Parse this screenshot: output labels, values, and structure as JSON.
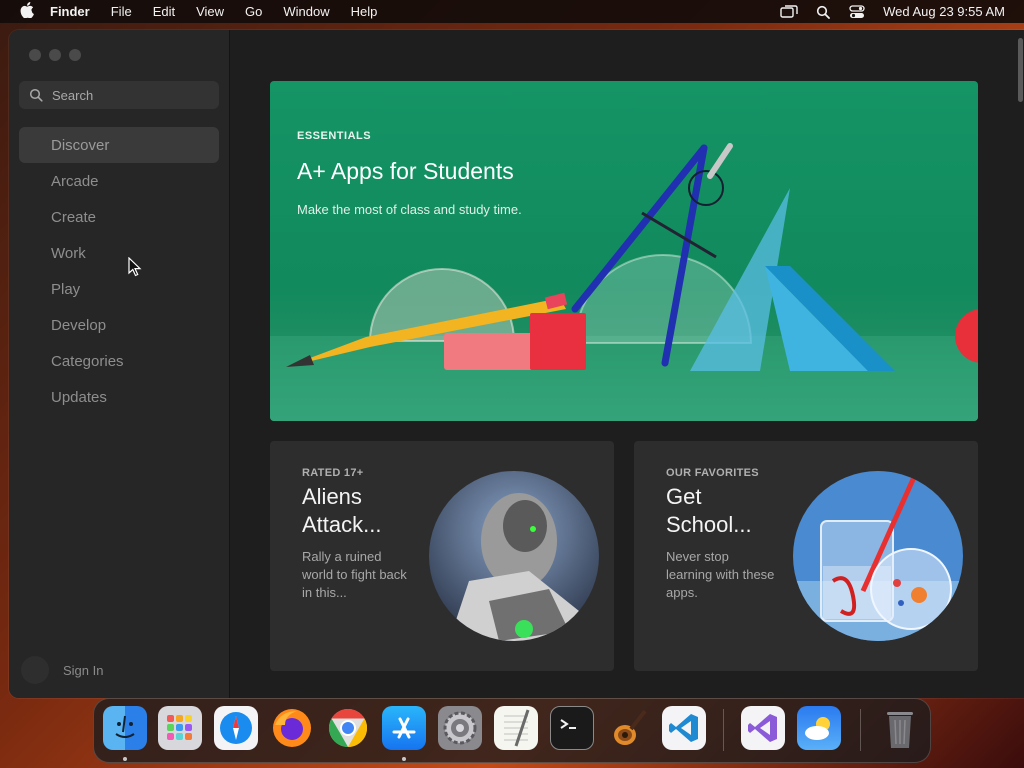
{
  "menubar": {
    "app_name": "Finder",
    "menus": [
      "File",
      "Edit",
      "View",
      "Go",
      "Window",
      "Help"
    ],
    "status_icons": [
      "screen-mirroring-icon",
      "spotlight-search-icon",
      "control-center-icon"
    ],
    "clock": "Wed Aug 23  9:55 AM"
  },
  "sidebar": {
    "search_placeholder": "Search",
    "items": [
      {
        "label": "Discover",
        "active": true
      },
      {
        "label": "Arcade"
      },
      {
        "label": "Create"
      },
      {
        "label": "Work"
      },
      {
        "label": "Play"
      },
      {
        "label": "Develop"
      },
      {
        "label": "Categories"
      },
      {
        "label": "Updates"
      }
    ],
    "signin_label": "Sign In"
  },
  "hero": {
    "eyebrow": "ESSENTIALS",
    "title": "A+ Apps for Students",
    "subtitle": "Make the most of class and study time.",
    "background_color": "#159466"
  },
  "cards": [
    {
      "eyebrow": "RATED 17+",
      "title": "Aliens Attack...",
      "subtitle": "Rally a ruined world to fight back in this..."
    },
    {
      "eyebrow": "OUR FAVORITES",
      "title": "Get School...",
      "subtitle": "Never stop learning with these apps."
    }
  ],
  "dock": {
    "apps": [
      {
        "name": "finder-icon",
        "running": true
      },
      {
        "name": "launchpad-icon",
        "running": false
      },
      {
        "name": "safari-icon",
        "running": false
      },
      {
        "name": "firefox-icon",
        "running": false
      },
      {
        "name": "chrome-icon",
        "running": false
      },
      {
        "name": "app-store-icon",
        "running": true
      },
      {
        "name": "system-settings-icon",
        "running": false
      },
      {
        "name": "textedit-icon",
        "running": false
      },
      {
        "name": "terminal-icon",
        "running": false
      },
      {
        "name": "garageband-icon",
        "running": false
      },
      {
        "name": "vscode-icon",
        "running": false
      },
      {
        "name": "visual-studio-icon",
        "running": false
      },
      {
        "name": "weather-icon",
        "running": false
      },
      {
        "name": "trash-icon",
        "running": false
      }
    ]
  },
  "colors": {
    "accent_green": "#159466",
    "window_bg": "#1e1e1e",
    "sidebar_bg": "#262626",
    "card_bg": "#2d2d2d"
  }
}
